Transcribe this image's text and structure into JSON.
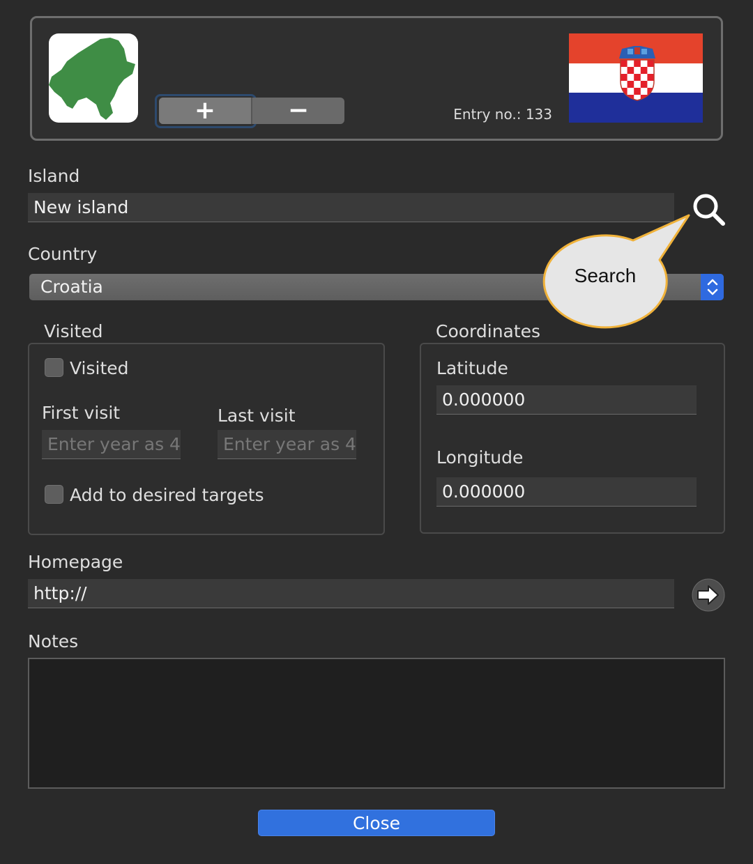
{
  "header": {
    "add_label": "+",
    "remove_label": "−",
    "entry_label": "Entry no.: 133",
    "flag_colors": [
      "#e4432c",
      "#ffffff",
      "#1f2f9a"
    ],
    "island_color": "#3f8d45"
  },
  "island": {
    "label": "Island",
    "value": "New island",
    "search_icon": "search-icon"
  },
  "tooltip": {
    "text": "Search"
  },
  "country": {
    "label": "Country",
    "selected": "Croatia"
  },
  "visited": {
    "group_label": "Visited",
    "checkbox_label": "Visited",
    "first_visit_label": "First visit",
    "last_visit_label": "Last visit",
    "first_visit_placeholder": "Enter year as 4",
    "last_visit_placeholder": "Enter year as 4",
    "desired_label": "Add to desired targets"
  },
  "coordinates": {
    "group_label": "Coordinates",
    "latitude_label": "Latitude",
    "latitude_value": "0.000000",
    "longitude_label": "Longitude",
    "longitude_value": "0.000000"
  },
  "homepage": {
    "label": "Homepage",
    "value": "http://",
    "open_icon": "arrow-right-icon"
  },
  "notes": {
    "label": "Notes",
    "value": ""
  },
  "footer": {
    "close_label": "Close"
  }
}
